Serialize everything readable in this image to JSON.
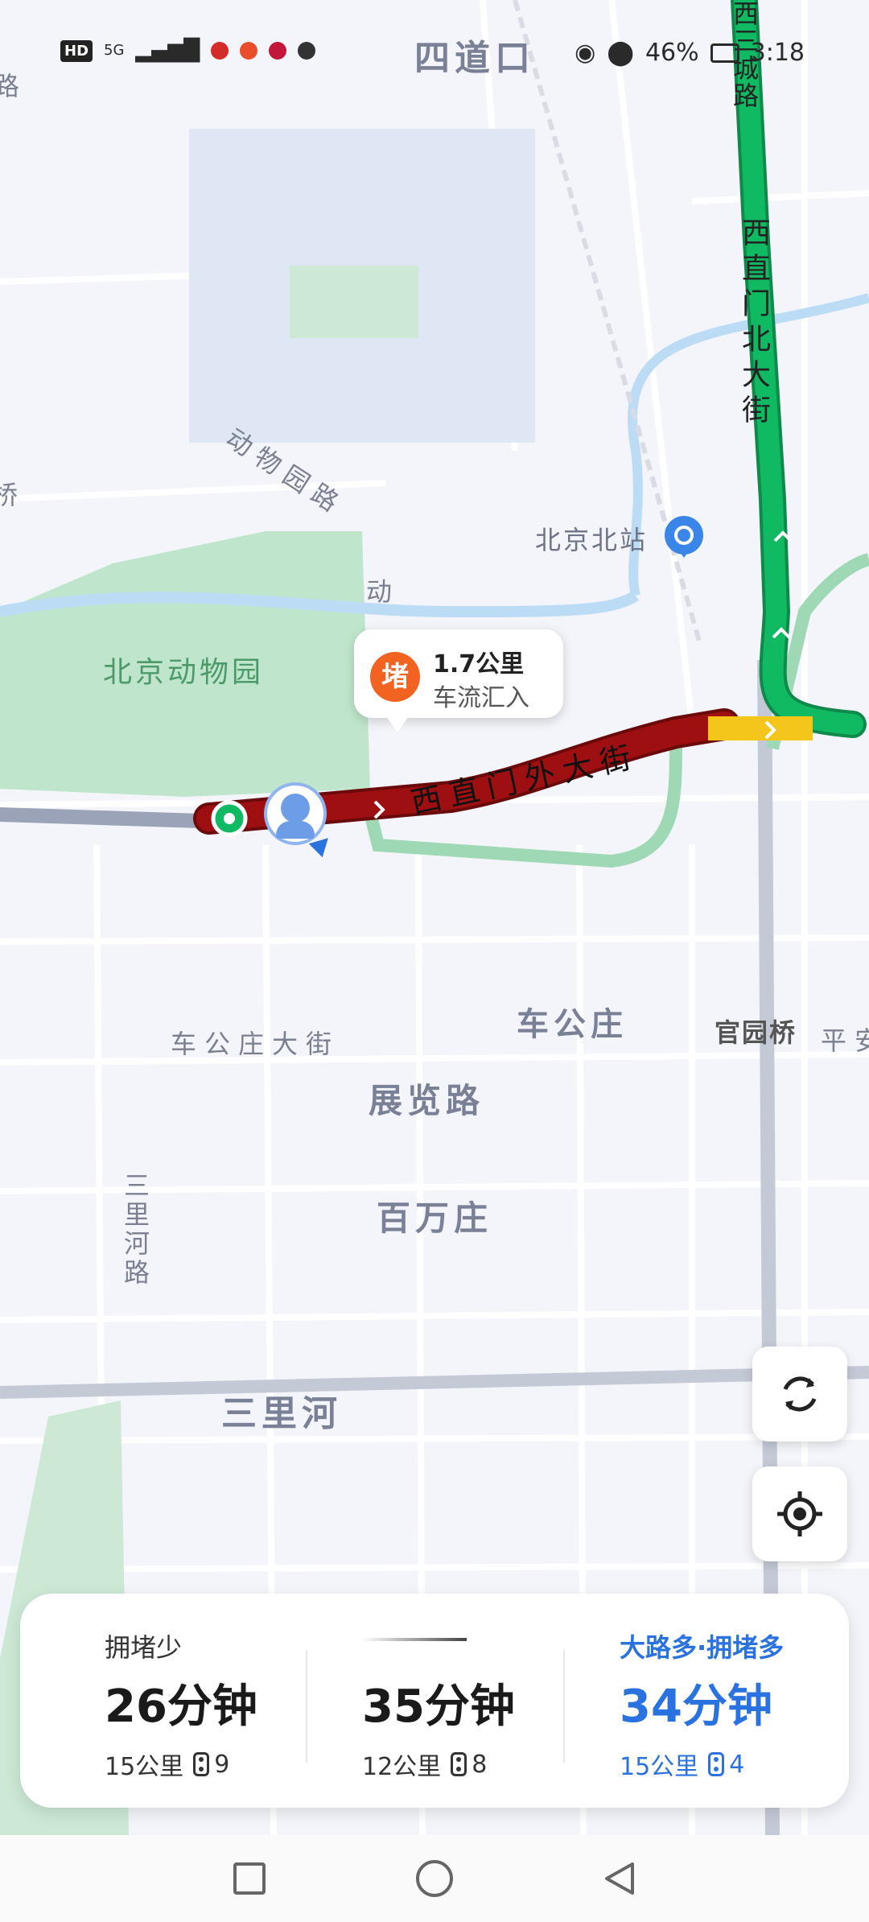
{
  "status_bar": {
    "hd": "HD",
    "network": "5G",
    "battery": "46%",
    "time": "3:18"
  },
  "map": {
    "labels": {
      "sidaokou": "四道口",
      "xichenglu": "西三城路",
      "xizhimen_north": "西直门北大街",
      "zoo_road": "动物园路",
      "beijing_north_station": "北京北站",
      "beijing_zoo": "北京动物园",
      "xizhimen_outer": "西直门外大街",
      "chegongzhuang_street": "车公庄大街",
      "chegongzhuang": "车公庄",
      "guanyuan_bridge": "官园桥",
      "ping": "平安",
      "zhanlanlu": "展览路",
      "baiwanzhuang": "百万庄",
      "sanlihe": "三里河",
      "sanlihe_road": "三里河路",
      "dong": "动",
      "qiao": "桥",
      "lu": "路"
    },
    "traffic_callout": {
      "icon_text": "堵",
      "distance": "1.7公里",
      "description": "车流汇入"
    },
    "buttons": {
      "refresh": "refresh-icon",
      "locate": "locate-icon"
    }
  },
  "routes": [
    {
      "tag": "拥堵少",
      "time": "26分钟",
      "distance": "15公里",
      "lights": "9",
      "selected": false
    },
    {
      "tag": "",
      "time": "35分钟",
      "distance": "12公里",
      "lights": "8",
      "selected": false
    },
    {
      "tag": "大路多·拥堵多",
      "time": "34分钟",
      "distance": "15公里",
      "lights": "4",
      "selected": true
    }
  ],
  "colors": {
    "selected_route": "#2a72e0",
    "jam_red": "#9e0f12",
    "flow_green": "#0fba62",
    "slow_yellow": "#f4c51a"
  }
}
